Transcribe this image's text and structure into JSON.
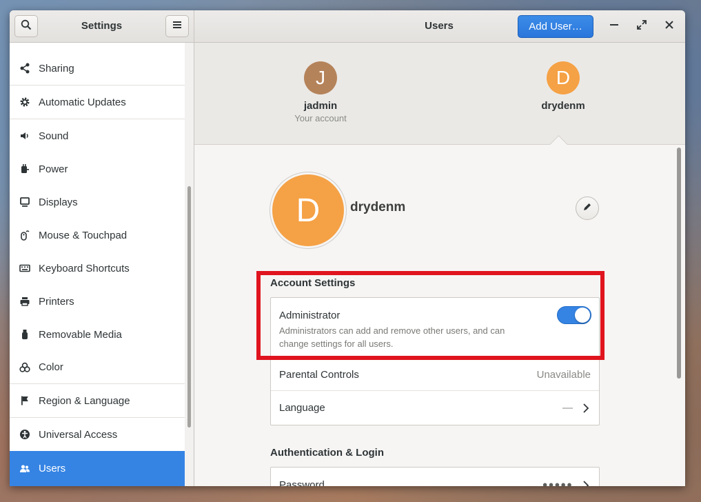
{
  "sidebar_header": {
    "title": "Settings",
    "search_icon": "search-icon",
    "menu_icon": "hamburger-menu-icon"
  },
  "header": {
    "title": "Users",
    "add_user_label": "Add User…"
  },
  "window_controls": [
    "minimize-icon",
    "maximize-icon",
    "close-icon"
  ],
  "sidebar": {
    "items": [
      {
        "label": "Sharing",
        "icon": "share-icon"
      },
      {
        "label": "Automatic Updates",
        "icon": "gear-icon"
      },
      {
        "label": "Sound",
        "icon": "speaker-icon"
      },
      {
        "label": "Power",
        "icon": "power-plug-icon"
      },
      {
        "label": "Displays",
        "icon": "monitor-icon"
      },
      {
        "label": "Mouse & Touchpad",
        "icon": "mouse-icon"
      },
      {
        "label": "Keyboard Shortcuts",
        "icon": "keyboard-icon"
      },
      {
        "label": "Printers",
        "icon": "printer-icon"
      },
      {
        "label": "Removable Media",
        "icon": "usb-drive-icon"
      },
      {
        "label": "Color",
        "icon": "color-circles-icon"
      },
      {
        "label": "Region & Language",
        "icon": "flag-icon"
      },
      {
        "label": "Universal Access",
        "icon": "accessibility-icon"
      },
      {
        "label": "Users",
        "icon": "users-icon",
        "selected": true
      }
    ]
  },
  "accounts": [
    {
      "initial": "J",
      "name": "jadmin",
      "subtitle": "Your account",
      "color": "#b5835a"
    },
    {
      "initial": "D",
      "name": "drydenm",
      "subtitle": "",
      "color": "#f5a145",
      "selected": true
    }
  ],
  "user": {
    "initial": "D",
    "name": "drydenm",
    "avatar_color": "#f5a145"
  },
  "account_settings": {
    "title": "Account Settings",
    "administrator": {
      "title": "Administrator",
      "description": "Administrators can add and remove other users, and can change settings for all users.",
      "enabled": true
    },
    "parental_controls": {
      "title": "Parental Controls",
      "value": "Unavailable"
    },
    "language": {
      "title": "Language",
      "value": "—"
    }
  },
  "auth": {
    "title": "Authentication & Login",
    "password": {
      "title": "Password",
      "value": "●●●●●"
    }
  },
  "colors": {
    "accent": "#3584e4",
    "highlight_border": "#e0141e"
  }
}
